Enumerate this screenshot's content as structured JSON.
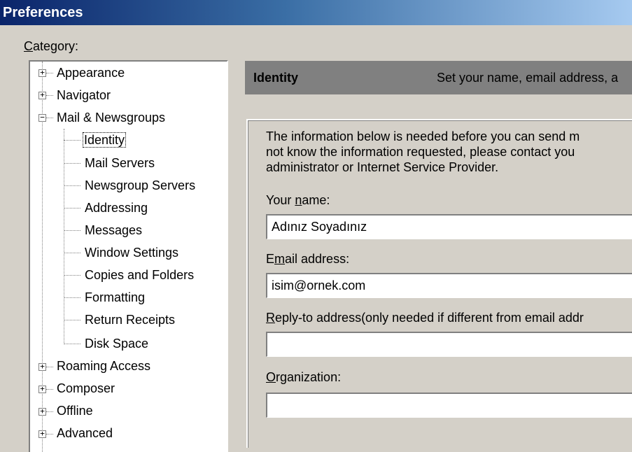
{
  "window": {
    "title": "Preferences"
  },
  "category_label": {
    "accel": "C",
    "rest": "ategory:"
  },
  "tree": {
    "items": [
      {
        "label": "Appearance"
      },
      {
        "label": "Navigator"
      },
      {
        "label": "Mail & Newsgroups"
      },
      {
        "label": "Identity"
      },
      {
        "label": "Mail Servers"
      },
      {
        "label": "Newsgroup Servers"
      },
      {
        "label": "Addressing"
      },
      {
        "label": "Messages"
      },
      {
        "label": "Window Settings"
      },
      {
        "label": "Copies and Folders"
      },
      {
        "label": "Formatting"
      },
      {
        "label": "Return Receipts"
      },
      {
        "label": "Disk Space"
      },
      {
        "label": "Roaming Access"
      },
      {
        "label": "Composer"
      },
      {
        "label": "Offline"
      },
      {
        "label": "Advanced"
      }
    ],
    "expander_plus": "+",
    "expander_minus": "−"
  },
  "panel": {
    "title": "Identity",
    "description": "Set your name, email address, a",
    "info_lines": [
      "The information below is needed before you can send m",
      "not know the information requested, please contact you",
      "administrator or Internet Service Provider."
    ],
    "fields": {
      "name": {
        "pre": "Your ",
        "accel": "n",
        "post": "ame:",
        "value": "Adınız Soyadınız"
      },
      "email": {
        "pre": "E",
        "accel": "m",
        "post": "ail address:",
        "value": "isim@ornek.com"
      },
      "reply": {
        "pre": "",
        "accel": "R",
        "post": "eply-to address(only needed if different from email addr",
        "value": ""
      },
      "org": {
        "pre": "",
        "accel": "O",
        "post": "rganization:",
        "value": ""
      }
    }
  }
}
